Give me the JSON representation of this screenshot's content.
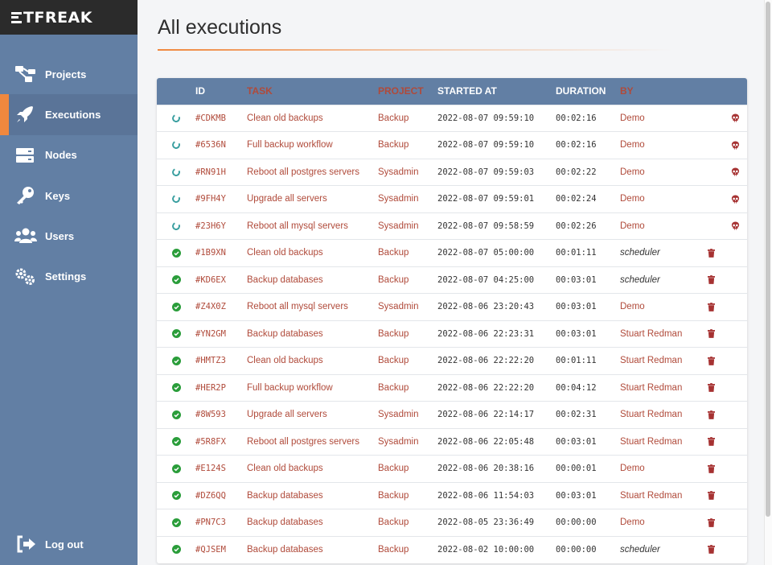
{
  "brand": {
    "logo_text": "TFREAK"
  },
  "sidebar": {
    "items": [
      {
        "label": "Projects",
        "icon": "projects-icon",
        "active": false
      },
      {
        "label": "Executions",
        "icon": "rocket-icon",
        "active": true
      },
      {
        "label": "Nodes",
        "icon": "server-icon",
        "active": false
      },
      {
        "label": "Keys",
        "icon": "key-icon",
        "active": false
      },
      {
        "label": "Users",
        "icon": "users-icon",
        "active": false
      },
      {
        "label": "Settings",
        "icon": "gears-icon",
        "active": false
      }
    ],
    "logout_label": "Log out"
  },
  "page": {
    "title": "All executions"
  },
  "table": {
    "headers": {
      "id": "ID",
      "task": "TASK",
      "project": "PROJECT",
      "started": "STARTED AT",
      "duration": "DURATION",
      "by": "BY"
    },
    "rows": [
      {
        "status": "running",
        "id": "#CDKMB",
        "task": "Clean old backups",
        "project": "Backup",
        "started": "2022-08-07 09:59:10",
        "duration": "00:02:16",
        "by": "Demo",
        "action": "kill"
      },
      {
        "status": "running",
        "id": "#6536N",
        "task": "Full backup workflow",
        "project": "Backup",
        "started": "2022-08-07 09:59:10",
        "duration": "00:02:16",
        "by": "Demo",
        "action": "kill"
      },
      {
        "status": "running",
        "id": "#RN91H",
        "task": "Reboot all postgres servers",
        "project": "Sysadmin",
        "started": "2022-08-07 09:59:03",
        "duration": "00:02:22",
        "by": "Demo",
        "action": "kill"
      },
      {
        "status": "running",
        "id": "#9FH4Y",
        "task": "Upgrade all servers",
        "project": "Sysadmin",
        "started": "2022-08-07 09:59:01",
        "duration": "00:02:24",
        "by": "Demo",
        "action": "kill"
      },
      {
        "status": "running",
        "id": "#23H6Y",
        "task": "Reboot all mysql servers",
        "project": "Sysadmin",
        "started": "2022-08-07 09:58:59",
        "duration": "00:02:26",
        "by": "Demo",
        "action": "kill"
      },
      {
        "status": "success",
        "id": "#1B9XN",
        "task": "Clean old backups",
        "project": "Backup",
        "started": "2022-08-07 05:00:00",
        "duration": "00:01:11",
        "by": "scheduler",
        "action": "delete"
      },
      {
        "status": "success",
        "id": "#KD6EX",
        "task": "Backup databases",
        "project": "Backup",
        "started": "2022-08-07 04:25:00",
        "duration": "00:03:01",
        "by": "scheduler",
        "action": "delete"
      },
      {
        "status": "success",
        "id": "#Z4X0Z",
        "task": "Reboot all mysql servers",
        "project": "Sysadmin",
        "started": "2022-08-06 23:20:43",
        "duration": "00:03:01",
        "by": "Demo",
        "action": "delete"
      },
      {
        "status": "success",
        "id": "#YN2GM",
        "task": "Backup databases",
        "project": "Backup",
        "started": "2022-08-06 22:23:31",
        "duration": "00:03:01",
        "by": "Stuart Redman",
        "action": "delete"
      },
      {
        "status": "success",
        "id": "#HMTZ3",
        "task": "Clean old backups",
        "project": "Backup",
        "started": "2022-08-06 22:22:20",
        "duration": "00:01:11",
        "by": "Stuart Redman",
        "action": "delete"
      },
      {
        "status": "success",
        "id": "#HER2P",
        "task": "Full backup workflow",
        "project": "Backup",
        "started": "2022-08-06 22:22:20",
        "duration": "00:04:12",
        "by": "Stuart Redman",
        "action": "delete"
      },
      {
        "status": "success",
        "id": "#8W593",
        "task": "Upgrade all servers",
        "project": "Sysadmin",
        "started": "2022-08-06 22:14:17",
        "duration": "00:02:31",
        "by": "Stuart Redman",
        "action": "delete"
      },
      {
        "status": "success",
        "id": "#5R8FX",
        "task": "Reboot all postgres servers",
        "project": "Sysadmin",
        "started": "2022-08-06 22:05:48",
        "duration": "00:03:01",
        "by": "Stuart Redman",
        "action": "delete"
      },
      {
        "status": "success",
        "id": "#E124S",
        "task": "Clean old backups",
        "project": "Backup",
        "started": "2022-08-06 20:38:16",
        "duration": "00:00:01",
        "by": "Demo",
        "action": "delete"
      },
      {
        "status": "success",
        "id": "#DZ6QQ",
        "task": "Backup databases",
        "project": "Backup",
        "started": "2022-08-06 11:54:03",
        "duration": "00:03:01",
        "by": "Stuart Redman",
        "action": "delete"
      },
      {
        "status": "success",
        "id": "#PN7C3",
        "task": "Backup databases",
        "project": "Backup",
        "started": "2022-08-05 23:36:49",
        "duration": "00:00:00",
        "by": "Demo",
        "action": "delete"
      },
      {
        "status": "success",
        "id": "#QJSEM",
        "task": "Backup databases",
        "project": "Backup",
        "started": "2022-08-02 10:00:00",
        "duration": "00:00:00",
        "by": "scheduler",
        "action": "delete"
      }
    ]
  },
  "colors": {
    "sidebar": "#627fa4",
    "accent": "#f0883e",
    "link": "#b04a3a",
    "success": "#2a9d3a",
    "running": "#3a9fa0",
    "danger": "#a63232"
  }
}
